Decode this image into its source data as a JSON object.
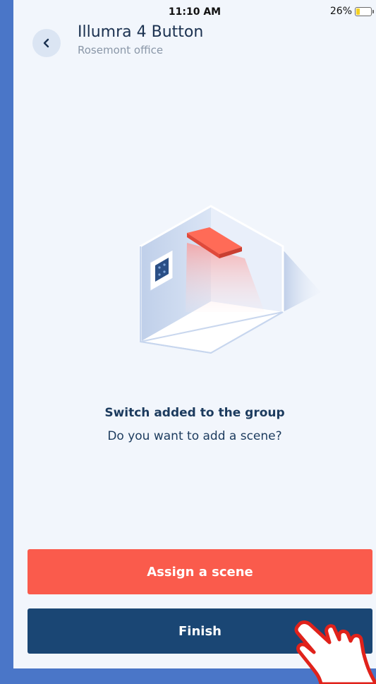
{
  "status_bar": {
    "time": "11:10 AM",
    "battery_percent": "26%",
    "battery_level": 0.26
  },
  "header": {
    "back_icon": "chevron-left-icon",
    "title": "Illumra 4 Button",
    "subtitle": "Rosemont office"
  },
  "message": {
    "title": "Switch added to the group",
    "subtitle": "Do you want to add a scene?"
  },
  "buttons": {
    "assign_label": "Assign a scene",
    "finish_label": "Finish"
  },
  "colors": {
    "assign_button": "#fa5b4c",
    "finish_button": "#1a4674",
    "background": "#f2f6fc",
    "outer": "#4a76c8"
  }
}
